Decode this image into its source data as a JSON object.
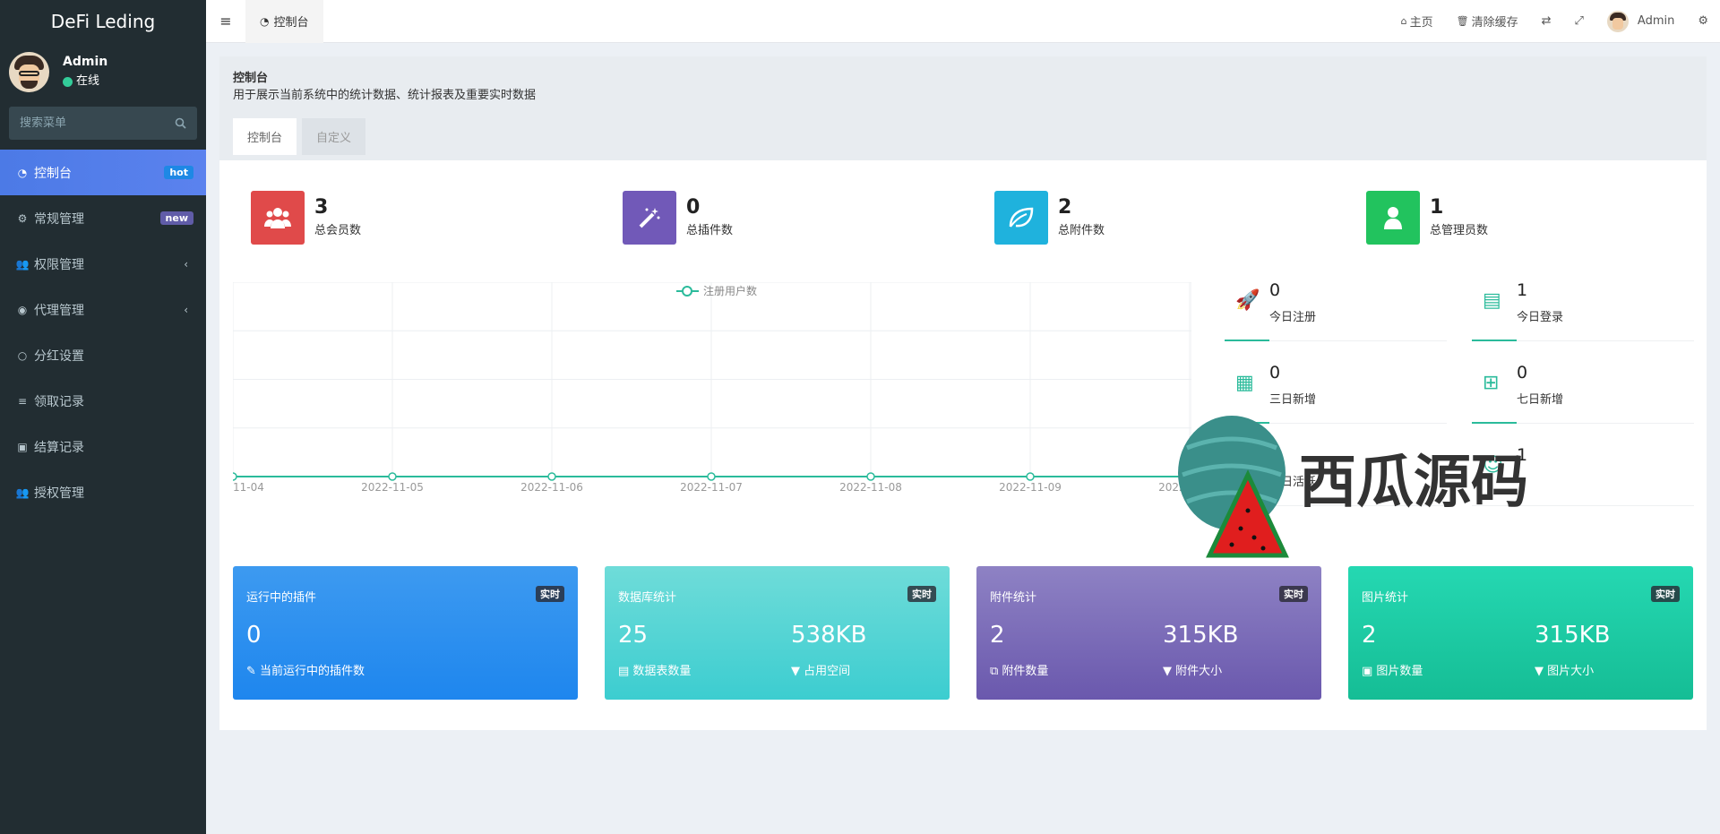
{
  "sidebar": {
    "brand": "DeFi Leding",
    "user": {
      "name": "Admin",
      "status": "在线"
    },
    "search": {
      "placeholder": "搜索菜单"
    },
    "items": [
      {
        "label": "控制台",
        "badge": "hot",
        "icon": "dashboard-icon"
      },
      {
        "label": "常规管理",
        "badge": "new",
        "icon": "cogs-icon"
      },
      {
        "label": "权限管理",
        "icon": "group-icon"
      },
      {
        "label": "代理管理",
        "icon": "user-circle-icon"
      },
      {
        "label": "分红设置",
        "icon": "circle-icon"
      },
      {
        "label": "领取记录",
        "icon": "list-icon"
      },
      {
        "label": "结算记录",
        "icon": "calc-icon"
      },
      {
        "label": "授权管理",
        "icon": "group-icon"
      }
    ]
  },
  "topbar": {
    "tab": "控制台",
    "home": "主页",
    "clear_cache": "清除缓存",
    "user": "Admin"
  },
  "header": {
    "title": "控制台",
    "subtitle": "用于展示当前系统中的统计数据、统计报表及重要实时数据",
    "tabs": [
      "控制台",
      "自定义"
    ]
  },
  "stats": [
    {
      "value": "3",
      "label": "总会员数",
      "color": "#e04a4a",
      "icon": "users-icon"
    },
    {
      "value": "0",
      "label": "总插件数",
      "color": "#7159b8",
      "icon": "magic-icon"
    },
    {
      "value": "2",
      "label": "总附件数",
      "color": "#1fb2dd",
      "icon": "leaf-icon"
    },
    {
      "value": "1",
      "label": "总管理员数",
      "color": "#22c35e",
      "icon": "user-icon"
    }
  ],
  "chart_data": {
    "type": "line",
    "title": "",
    "x": [
      "11-04",
      "2022-11-05",
      "2022-11-06",
      "2022-11-07",
      "2022-11-08",
      "2022-11-09",
      "2022-11-10"
    ],
    "series": [
      {
        "name": "注册用户数",
        "values": [
          0,
          0,
          0,
          0,
          0,
          0,
          0
        ]
      }
    ],
    "grid": true,
    "legend": "top-center"
  },
  "mini_stats": [
    {
      "value": "0",
      "label": "今日注册",
      "icon": "rocket-icon"
    },
    {
      "value": "1",
      "label": "今日登录",
      "icon": "vcard-icon"
    },
    {
      "value": "0",
      "label": "三日新增",
      "icon": "calendar-icon"
    },
    {
      "value": "0",
      "label": "七日新增",
      "icon": "calendar-plus-icon"
    },
    {
      "value": "1",
      "label": "七日活跃",
      "icon": "user-check-icon"
    },
    {
      "value": "1",
      "label": "",
      "icon": "user-check-icon"
    }
  ],
  "cards": [
    {
      "title": "运行中的插件",
      "badge": "实时",
      "left_value": "0",
      "left_label": "当前运行中的插件数",
      "right_value": "",
      "right_label": ""
    },
    {
      "title": "数据库统计",
      "badge": "实时",
      "left_value": "25",
      "left_label": "数据表数量",
      "right_value": "538KB",
      "right_label": "占用空间"
    },
    {
      "title": "附件统计",
      "badge": "实时",
      "left_value": "2",
      "left_label": "附件数量",
      "right_value": "315KB",
      "right_label": "附件大小"
    },
    {
      "title": "图片统计",
      "badge": "实时",
      "left_value": "2",
      "left_label": "图片数量",
      "right_value": "315KB",
      "right_label": "图片大小"
    }
  ],
  "watermark": {
    "text": "西瓜源码"
  }
}
